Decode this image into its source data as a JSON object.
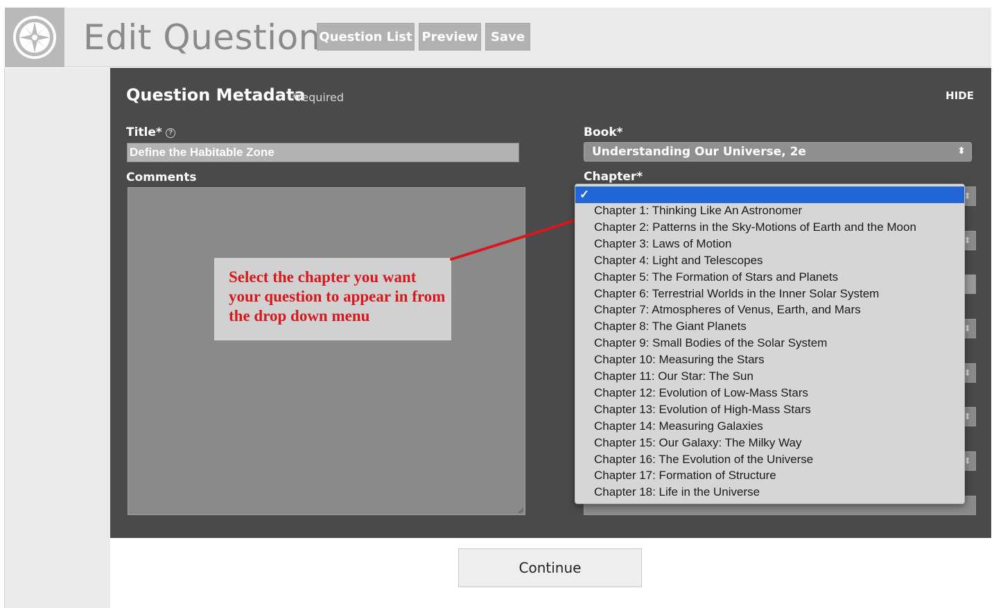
{
  "header": {
    "title": "Edit Question",
    "logo_icon": "compass-icon",
    "buttons": [
      {
        "label": "Question List"
      },
      {
        "label": "Preview"
      },
      {
        "label": "Save"
      }
    ]
  },
  "metadata": {
    "title": "Question Metadata",
    "required_note": "*required",
    "hide_label": "HIDE",
    "title_label": "Title*",
    "title_value": "Define the Habitable Zone",
    "comments_label": "Comments",
    "book_label": "Book*",
    "book_value": "Understanding Our Universe, 2e",
    "chapter_label": "Chapter*"
  },
  "chapter_dropdown": {
    "selected_mark": "✓",
    "options": [
      "Chapter 1: Thinking Like An Astronomer",
      "Chapter 2: Patterns in the Sky-Motions of Earth and the Moon",
      "Chapter 3: Laws of Motion",
      "Chapter 4: Light and Telescopes",
      "Chapter 5: The Formation of Stars and Planets",
      "Chapter 6: Terrestrial Worlds in the Inner Solar System",
      "Chapter 7: Atmospheres of Venus, Earth, and Mars",
      "Chapter 8: The Giant Planets",
      "Chapter 9: Small Bodies of the Solar System",
      "Chapter 10: Measuring the Stars",
      "Chapter 11: Our Star: The Sun",
      "Chapter 12: Evolution of Low-Mass Stars",
      "Chapter 13: Evolution of High-Mass Stars",
      "Chapter 14: Measuring Galaxies",
      "Chapter 15: Our Galaxy: The Milky Way",
      "Chapter 16: The Evolution of the Universe",
      "Chapter 17: Formation of Structure",
      "Chapter 18: Life in the Universe"
    ]
  },
  "callout": {
    "text": "Select the chapter you want your question to appear in from the drop down menu",
    "color": "#d8181c"
  },
  "footer": {
    "continue_label": "Continue"
  }
}
